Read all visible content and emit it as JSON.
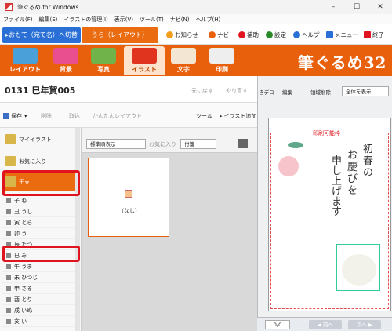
{
  "window": {
    "title": "筆ぐるめ for Windows"
  },
  "window_controls": {
    "minimize": "–",
    "maximize": "☐",
    "close": "✕"
  },
  "menu": [
    "ファイル(F)",
    "編集(E)",
    "イラストの管理(I)",
    "表示(V)",
    "ツール(T)",
    "ナビ(N)",
    "ヘルプ(H)"
  ],
  "mode_tabs": {
    "omote": "▸おもて（宛て名）へ切替",
    "ura": "うら（レイアウト）"
  },
  "top_links": {
    "news": "お知らせ",
    "navi": "ナビ",
    "aid": "補助",
    "settings": "設定",
    "help": "ヘルプ",
    "menu": "メニュー",
    "exit": "終了"
  },
  "ribbon": {
    "layout": "レイアウト",
    "background": "背景",
    "photo": "写真",
    "illust": "イラスト",
    "text": "文字",
    "print": "印刷",
    "brand": "筆ぐるめ32"
  },
  "document": {
    "number": "0131",
    "name": "巳年賀005",
    "undo": "元に戻す",
    "redo": "やり直す"
  },
  "toolbar": {
    "save": "保存",
    "delete": "削除",
    "import": "取込",
    "easy_layout": "かんたんレイアウト",
    "tools": "ツール",
    "add_illust": "イラスト追加"
  },
  "categories": {
    "my_illust": "マイイラスト",
    "favorites": "お気に入り",
    "eto": "干支"
  },
  "eto_items": [
    "子 ね",
    "丑 うし",
    "寅 とら",
    "卯 う",
    "辰 たつ",
    "巳 み",
    "午 うま",
    "未 ひつじ",
    "申 さる",
    "酉 とり",
    "戌 いぬ",
    "亥 い"
  ],
  "mid_toolbar": {
    "sort": "標準順表示",
    "favorite": "お気に入り",
    "attach": "付箋"
  },
  "thumbnail": {
    "label": "（なし）"
  },
  "preview": {
    "tab": "きデコ",
    "edit": "編集",
    "area_delete": "領域削除",
    "zoom": "全体を表示",
    "print_frame": "印刷可能枠",
    "greeting_line1": "初春の",
    "greeting_line2": "お慶びを",
    "greeting_line3": "申し上げます"
  },
  "pager": {
    "count": "0/0",
    "prev": "◀ 前へ",
    "next": "次へ ▶"
  }
}
